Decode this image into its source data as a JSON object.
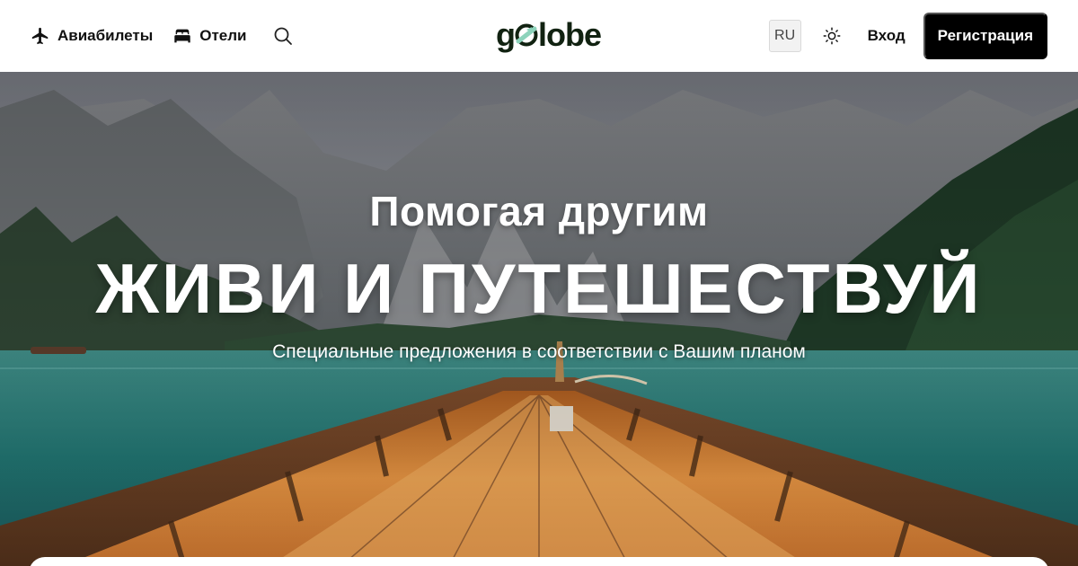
{
  "header": {
    "nav": [
      {
        "label": "Авиабилеты",
        "icon": "airplane-icon"
      },
      {
        "label": "Отели",
        "icon": "bed-icon"
      }
    ],
    "search_icon": "search-icon",
    "logo": {
      "prefix": "g",
      "suffix": "lobe",
      "mark_color": "#8DD3BB"
    },
    "lang": "RU",
    "theme_icon": "sun-icon",
    "login_label": "Вход",
    "signup_label": "Регистрация"
  },
  "hero": {
    "kicker": "Помогая другим",
    "title": "ЖИВИ И ПУТЕШЕСТВУЙ",
    "subtitle": "Специальные предложения в соответствии с Вашим планом"
  },
  "colors": {
    "brand_dark": "#112211",
    "brand_mint": "#8DD3BB",
    "signup_bg": "#000000"
  }
}
